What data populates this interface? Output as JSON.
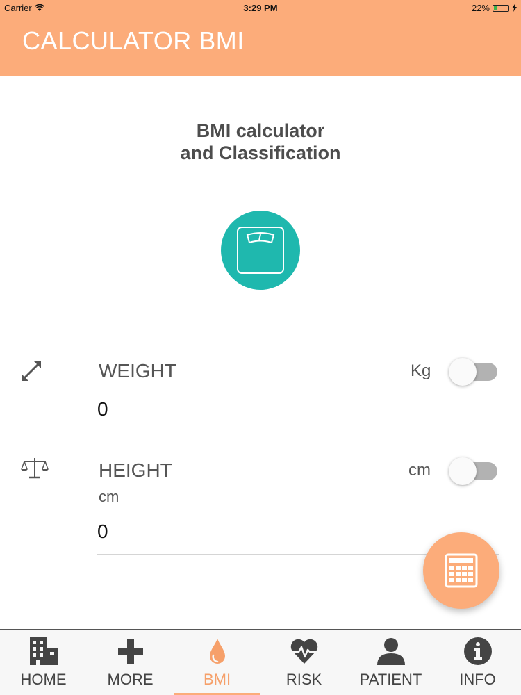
{
  "status_bar": {
    "carrier": "Carrier",
    "time": "3:29 PM",
    "battery": "22%",
    "battery_level": 0.22
  },
  "header": {
    "title": "CALCULATOR BMI"
  },
  "main": {
    "heading_line1": "BMI calculator",
    "heading_line2": "and Classification",
    "scale_icon": "bathroom-scale-icon",
    "weight": {
      "icon": "expand-arrows-icon",
      "label": "WEIGHT",
      "unit": "Kg",
      "value": "0",
      "toggle_on": false
    },
    "height": {
      "icon": "balance-scale-icon",
      "label": "HEIGHT",
      "sublabel": "cm",
      "unit": "cm",
      "value": "0",
      "toggle_on": false
    },
    "calculate_icon": "calculator-icon"
  },
  "tabs": [
    {
      "label": "HOME",
      "icon": "buildings-icon"
    },
    {
      "label": "MORE",
      "icon": "plus-icon"
    },
    {
      "label": "BMI",
      "icon": "drop-icon",
      "active": true
    },
    {
      "label": "RISK",
      "icon": "heart-pulse-icon"
    },
    {
      "label": "PATIENT",
      "icon": "person-icon"
    },
    {
      "label": "INFO",
      "icon": "info-icon"
    }
  ],
  "colors": {
    "accent": "#fcac7a",
    "teal": "#1fb8ae",
    "active_tab": "#f6a06a"
  }
}
